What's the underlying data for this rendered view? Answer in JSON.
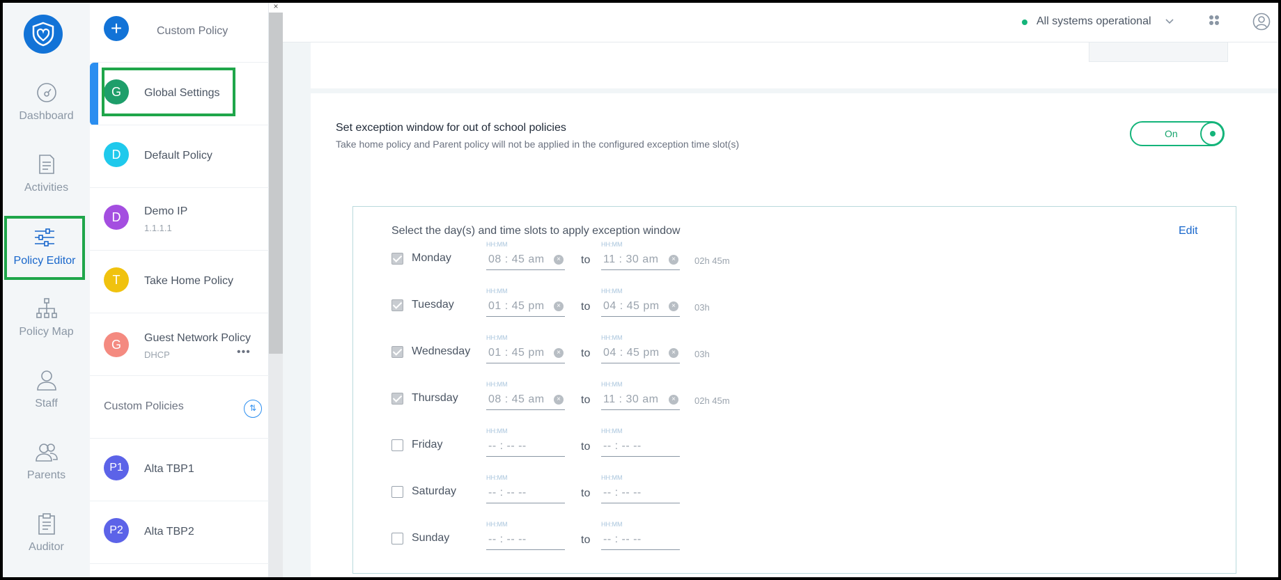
{
  "colors": {
    "brand": "#1273d7",
    "accent_green": "#14b47a",
    "highlight": "#1fa64a",
    "link": "#1766cb"
  },
  "nav": {
    "items": [
      {
        "label": "Dashboard",
        "icon": "dashboard-icon"
      },
      {
        "label": "Activities",
        "icon": "document-icon"
      },
      {
        "label": "Policy Editor",
        "icon": "sliders-icon",
        "active": true
      },
      {
        "label": "Policy Map",
        "icon": "sitemap-icon"
      },
      {
        "label": "Staff",
        "icon": "person-icon"
      },
      {
        "label": "Parents",
        "icon": "people-icon"
      },
      {
        "label": "Auditor",
        "icon": "clipboard-icon"
      }
    ]
  },
  "policies": {
    "add_label": "Custom Policy",
    "items": [
      {
        "initial": "G",
        "name": "Global Settings",
        "color": "#1e9e6a",
        "selected": true
      },
      {
        "initial": "D",
        "name": "Default Policy",
        "color": "#1fc9ec"
      },
      {
        "initial": "D",
        "name": "Demo IP",
        "sub": "1.1.1.1",
        "color": "#a44ee0"
      },
      {
        "initial": "T",
        "name": "Take Home Policy",
        "color": "#f0c20e"
      },
      {
        "initial": "G",
        "name": "Guest Network Policy",
        "sub": "DHCP",
        "color": "#f48a80"
      }
    ],
    "custom_header": "Custom Policies",
    "custom_items": [
      {
        "initial": "P1",
        "name": "Alta TBP1",
        "color": "#5c63e8"
      },
      {
        "initial": "P2",
        "name": "Alta TBP2",
        "color": "#5c63e8"
      }
    ]
  },
  "header": {
    "status": "All systems operational"
  },
  "exception": {
    "title": "Set exception window for out of school policies",
    "subtitle": "Take home policy and Parent policy will not be applied in the configured exception time slot(s)",
    "toggle_label": "On",
    "panel_title": "Select the day(s) and time slots to apply exception window",
    "edit_label": "Edit",
    "hint": "HH:MM",
    "to_label": "to",
    "days": [
      {
        "name": "Monday",
        "checked": true,
        "from": "08 : 45  am",
        "to": "11 : 30  am",
        "duration": "02h 45m"
      },
      {
        "name": "Tuesday",
        "checked": true,
        "from": "01 : 45  pm",
        "to": "04 : 45  pm",
        "duration": "03h"
      },
      {
        "name": "Wednesday",
        "checked": true,
        "from": "01 : 45  pm",
        "to": "04 : 45  pm",
        "duration": "03h"
      },
      {
        "name": "Thursday",
        "checked": true,
        "from": "08 : 45  am",
        "to": "11 : 30  am",
        "duration": "02h 45m"
      },
      {
        "name": "Friday",
        "checked": false,
        "from": "-- : --   --",
        "to": "-- : --   --",
        "duration": ""
      },
      {
        "name": "Saturday",
        "checked": false,
        "from": "-- : --   --",
        "to": "-- : --   --",
        "duration": ""
      },
      {
        "name": "Sunday",
        "checked": false,
        "from": "-- : --   --",
        "to": "-- : --   --",
        "duration": ""
      }
    ]
  }
}
